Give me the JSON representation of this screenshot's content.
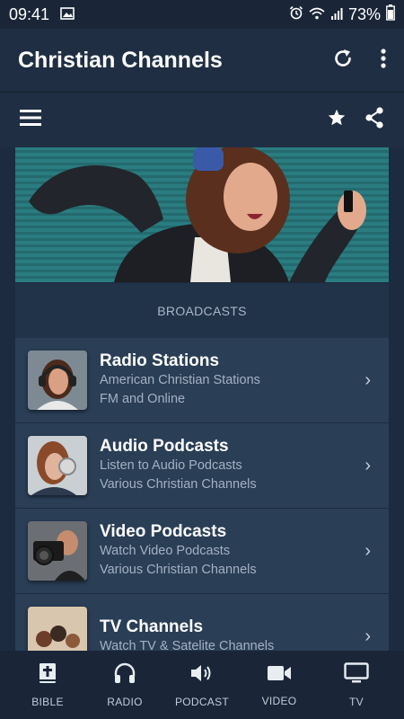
{
  "status": {
    "time": "09:41",
    "battery": "73%"
  },
  "appbar": {
    "title": "Christian Channels"
  },
  "section": {
    "label": "BROADCASTS"
  },
  "items": [
    {
      "title": "Radio Stations",
      "line1": "American Christian Stations",
      "line2": "FM and Online"
    },
    {
      "title": "Audio Podcasts",
      "line1": "Listen to Audio Podcasts",
      "line2": "Various Christian Channels"
    },
    {
      "title": "Video Podcasts",
      "line1": "Watch Video Podcasts",
      "line2": "Various Christian Channels"
    },
    {
      "title": "TV Channels",
      "line1": "Watch TV & Satelite Channels",
      "line2": ""
    }
  ],
  "nav": [
    {
      "label": "BIBLE",
      "icon": "bible-icon"
    },
    {
      "label": "RADIO",
      "icon": "headphones-icon"
    },
    {
      "label": "PODCAST",
      "icon": "speaker-icon"
    },
    {
      "label": "VIDEO",
      "icon": "video-camera-icon"
    },
    {
      "label": "TV",
      "icon": "tv-icon"
    }
  ],
  "colors": {
    "background": "#1c2b3f",
    "appbar": "#1f2e42",
    "card": "#2a3e56",
    "muted_text": "#a3b1c2"
  }
}
